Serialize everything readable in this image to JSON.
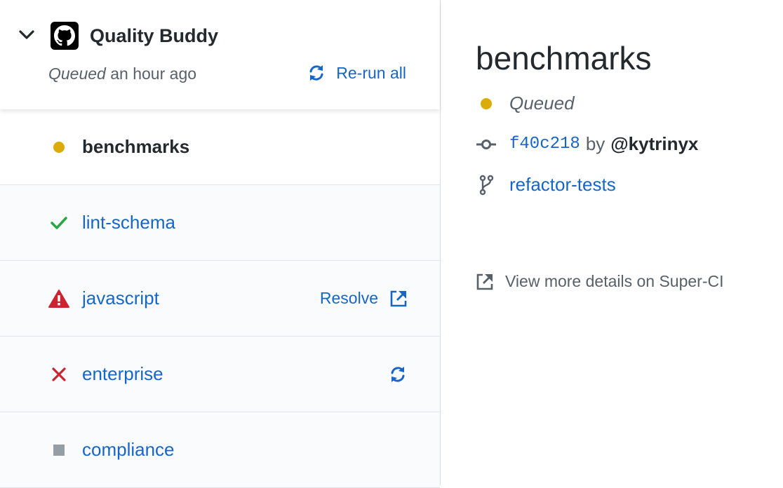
{
  "suite": {
    "app_name": "Quality Buddy",
    "status_word": "Queued",
    "status_time": "an hour ago",
    "rerun_all_label": "Re-run all"
  },
  "runs": [
    {
      "name": "benchmarks",
      "status": "queued",
      "selected": true
    },
    {
      "name": "lint-schema",
      "status": "success"
    },
    {
      "name": "javascript",
      "status": "action_required",
      "action_label": "Resolve"
    },
    {
      "name": "enterprise",
      "status": "failure"
    },
    {
      "name": "compliance",
      "status": "cancelled"
    }
  ],
  "detail": {
    "title": "benchmarks",
    "status": "Queued",
    "commit_sha": "f40c218",
    "by_label": "by",
    "author": "@kytrinyx",
    "branch": "refactor-tests",
    "more_details_label": "View more details on Super-CI"
  },
  "colors": {
    "link": "#1766c7",
    "queued": "#dbab09",
    "success": "#28a745",
    "failure": "#cb2431",
    "cancelled": "#959da5"
  }
}
